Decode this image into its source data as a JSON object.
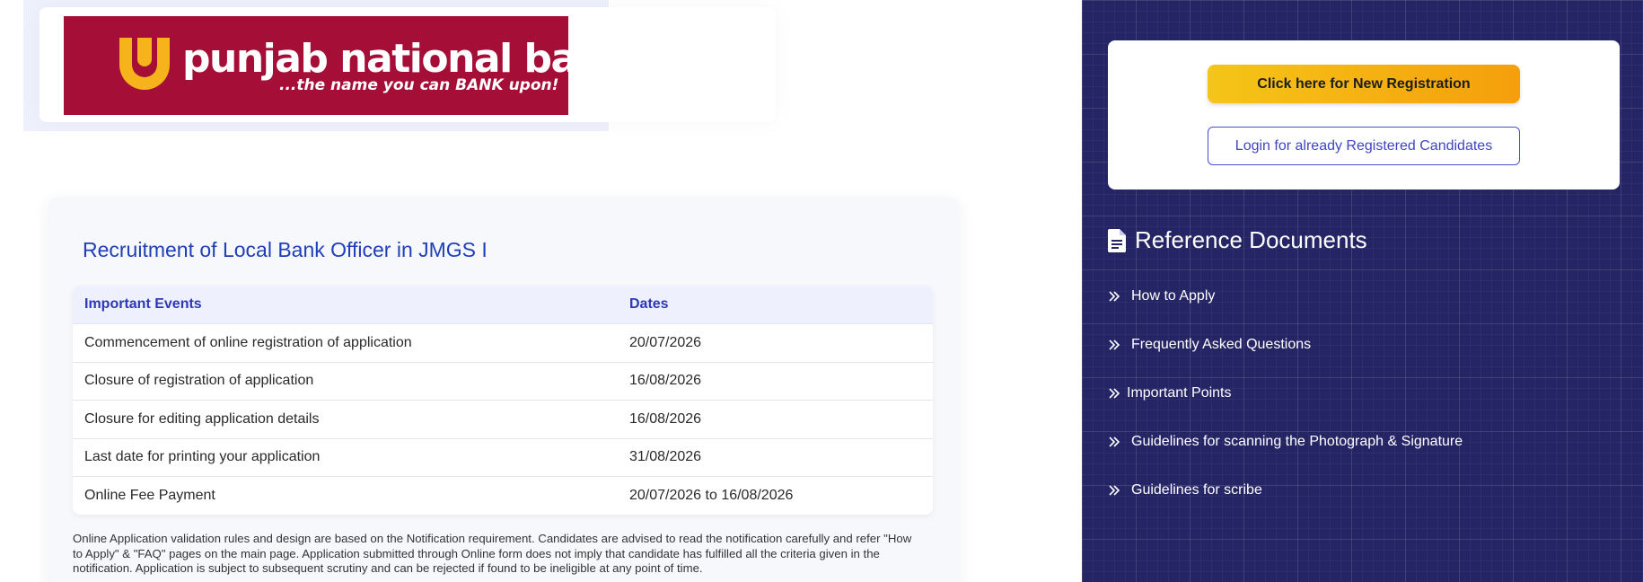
{
  "logo": {
    "name": "punjab national bank",
    "tagline": "...the name you can BANK upon!",
    "colors": {
      "banner": "#a50f37",
      "mark": "#f6b31c"
    }
  },
  "main": {
    "title": "Recruitment of Local Bank Officer in JMGS I",
    "table": {
      "headers": [
        "Important Events",
        "Dates"
      ],
      "rows": [
        [
          "Commencement of online registration of application",
          "20/07/2026"
        ],
        [
          "Closure of registration of application",
          "16/08/2026"
        ],
        [
          "Closure for editing application details",
          "16/08/2026"
        ],
        [
          "Last date for printing your application",
          "31/08/2026"
        ],
        [
          "Online Fee Payment",
          "20/07/2026 to 16/08/2026"
        ]
      ]
    },
    "disclaimer": "Online Application validation rules and design are based on the Notification requirement. Candidates are advised to read the notification carefully and refer \"How to Apply\" & \"FAQ\" pages on the main page. Application submitted through Online form does not imply that candidate has fulfilled all the criteria given in the notification. Application is subject to subsequent scrutiny and can be rejected if found to be ineligible at any point of time."
  },
  "sidebar": {
    "new_registration_label": "Click here for New Registration",
    "login_label": "Login for already Registered Candidates",
    "reference_title": "Reference Documents",
    "reference_icon": "document-icon",
    "reference_items": [
      "How to Apply",
      "Frequently Asked Questions",
      "Important Points",
      "Guidelines for scanning the Photograph & Signature",
      "Guidelines for scribe"
    ],
    "colors": {
      "background": "#252566",
      "button_accent": "#f5b514",
      "link": "#3f45c2"
    }
  }
}
